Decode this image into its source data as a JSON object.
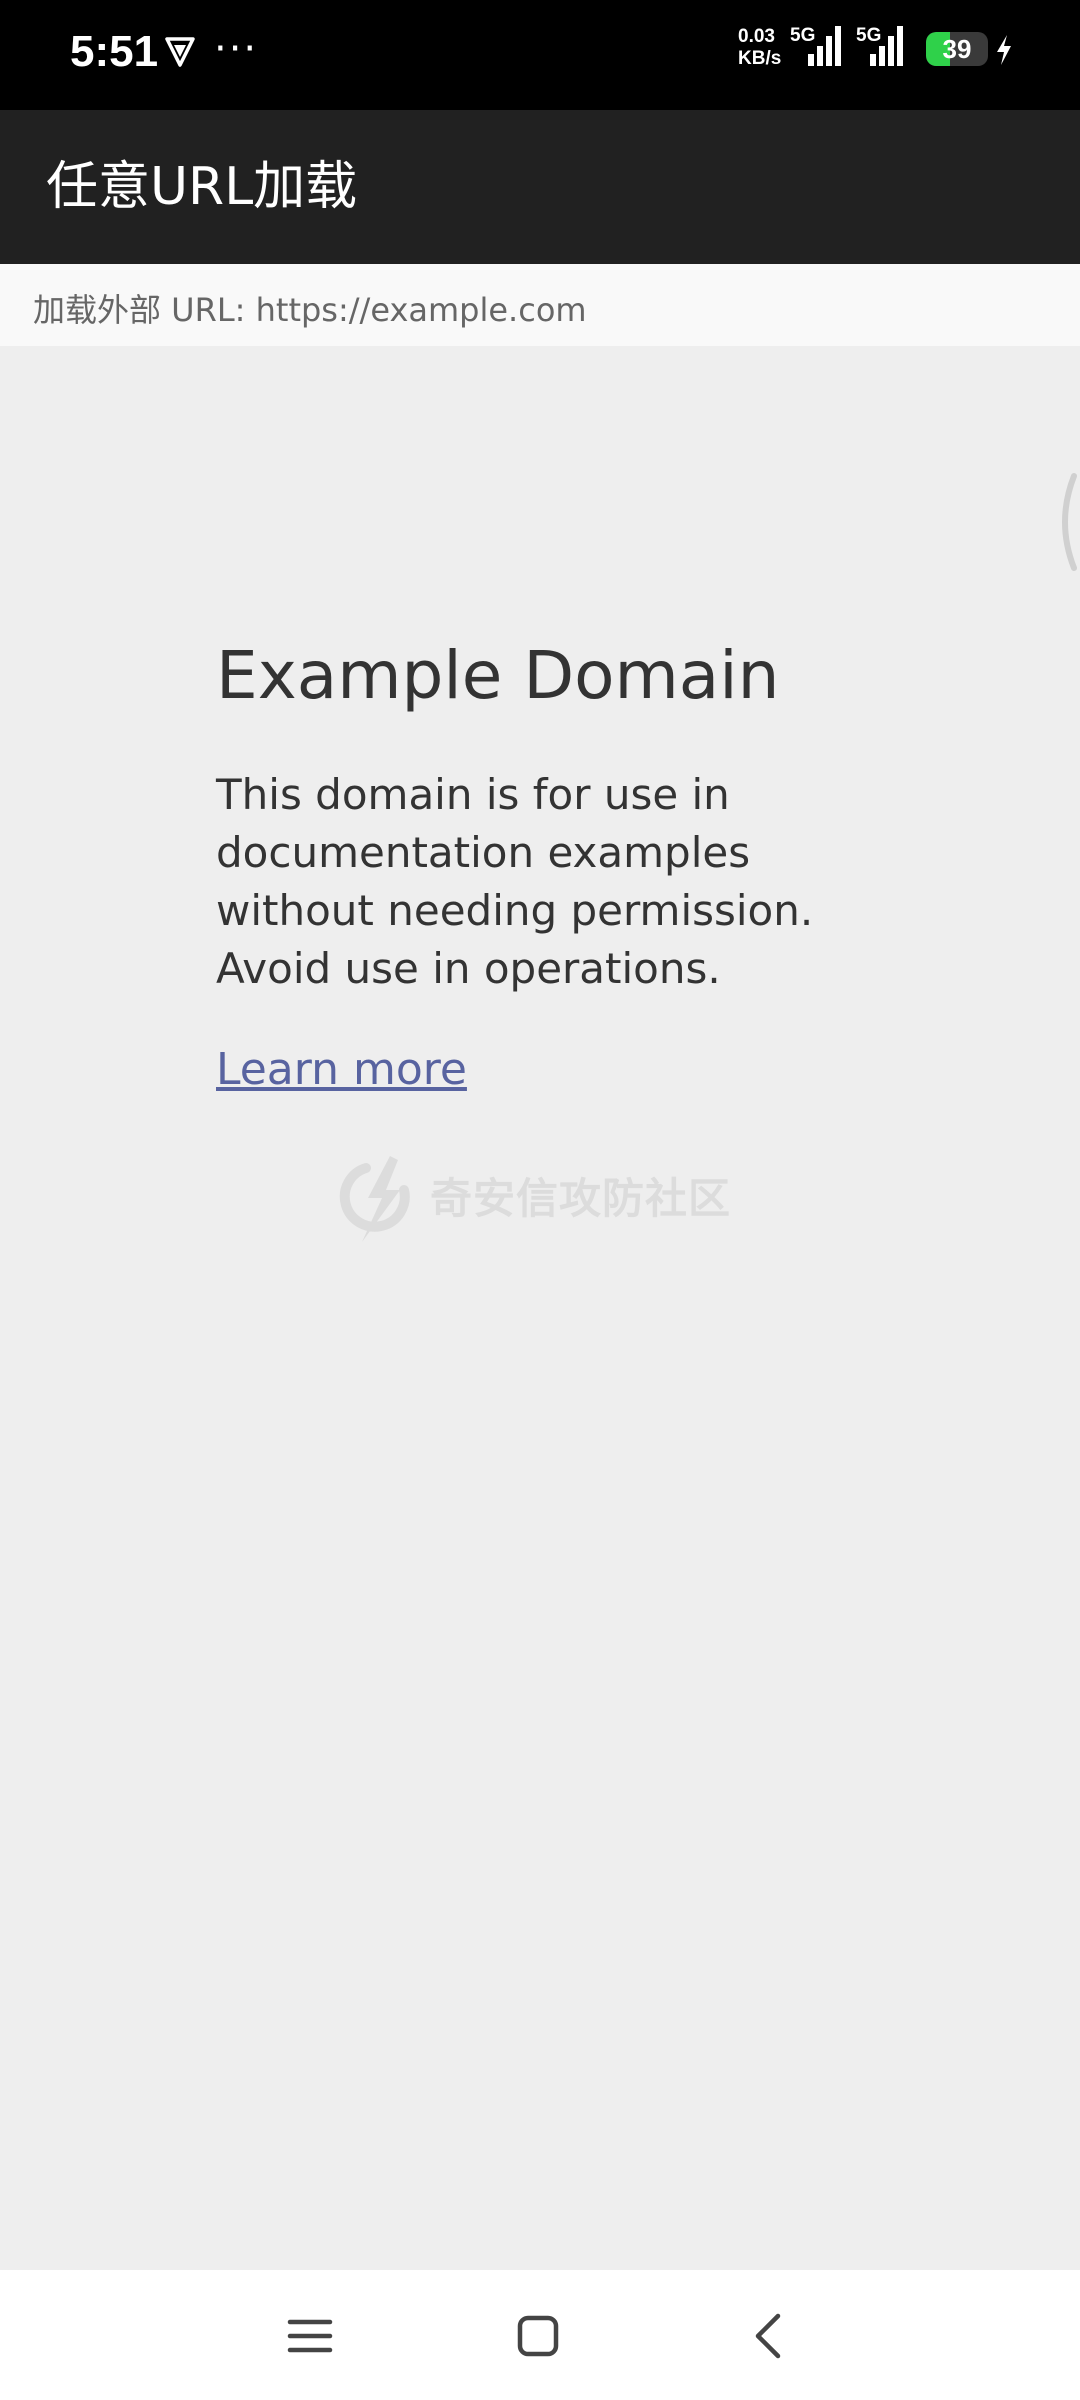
{
  "status_bar": {
    "time": "5:51",
    "more": "···",
    "net_speed_value": "0.03",
    "net_speed_unit": "KB/s",
    "signal1_label": "5G",
    "signal2_label": "5G",
    "battery_level": 39,
    "battery_text": "39",
    "battery_color": "#2fd14a",
    "icons": [
      "vpn-shield-icon",
      "signal-icon",
      "battery-icon",
      "charging-bolt-icon"
    ]
  },
  "app_bar": {
    "title": "任意URL加载",
    "background": "#212121"
  },
  "url_label": {
    "text": "加载外部 URL: https://example.com"
  },
  "webpage": {
    "heading": "Example Domain",
    "body": "This domain is for use in documentation examples without needing permission. Avoid use in operations.",
    "link": "Learn more",
    "link_color": "#5863a0",
    "watermark_text": "奇安信攻防社区"
  },
  "nav_bar": {
    "icons": [
      "menu-icon",
      "home-icon",
      "back-icon"
    ]
  }
}
